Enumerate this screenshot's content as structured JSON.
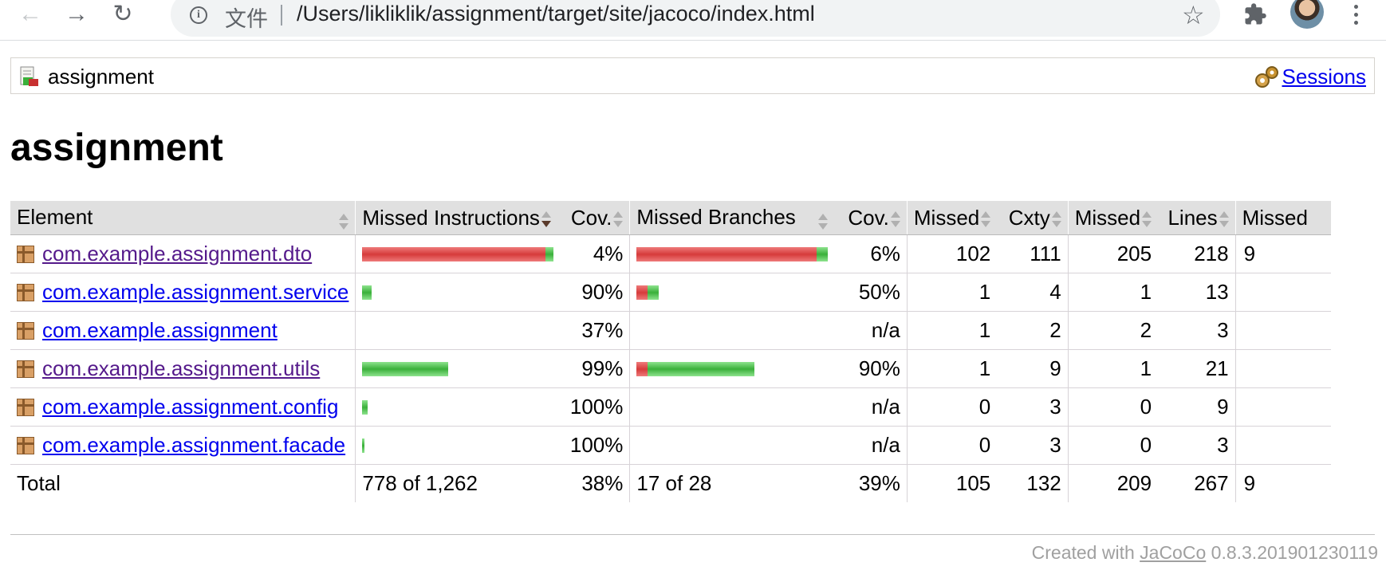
{
  "browser": {
    "scheme_label": "文件",
    "url": "/Users/likliklik/assignment/target/site/jacoco/index.html",
    "back_icon": "back-arrow-icon",
    "forward_icon": "forward-arrow-icon",
    "reload_icon": "reload-icon",
    "info_icon": "info-icon",
    "star_icon": "star-icon",
    "extensions_icon": "puzzle-icon",
    "menu_icon": "three-dots-icon"
  },
  "breadcrumb": {
    "label": "assignment",
    "sessions_label": "Sessions"
  },
  "page": {
    "title": "assignment"
  },
  "table": {
    "headers": {
      "element": "Element",
      "missed_instructions": "Missed Instructions",
      "cov1": "Cov.",
      "missed_branches": "Missed Branches",
      "cov2": "Cov.",
      "missed_cxty": "Missed",
      "cxty": "Cxty",
      "missed_lines": "Missed",
      "lines": "Lines",
      "missed_methods": "Missed"
    },
    "rows": [
      {
        "name": "com.example.assignment.dto",
        "visited": true,
        "instr_missed_frac": 0.96,
        "instr_covered_frac": 0.04,
        "instr_cov": "4%",
        "br_missed_frac": 0.94,
        "br_covered_frac": 0.06,
        "br_cov": "6%",
        "missed_cxty": "102",
        "cxty": "111",
        "missed_lines": "205",
        "lines": "218",
        "missed_methods": "9"
      },
      {
        "name": "com.example.assignment.service",
        "visited": false,
        "instr_missed_frac": 0.0,
        "instr_covered_frac": 0.05,
        "instr_cov": "90%",
        "br_missed_frac": 0.06,
        "br_covered_frac": 0.06,
        "br_cov": "50%",
        "missed_cxty": "1",
        "cxty": "4",
        "missed_lines": "1",
        "lines": "13",
        "missed_methods": ""
      },
      {
        "name": "com.example.assignment",
        "visited": false,
        "instr_missed_frac": 0,
        "instr_covered_frac": 0,
        "instr_cov": "37%",
        "br_missed_frac": 0,
        "br_covered_frac": 0,
        "br_cov": "n/a",
        "missed_cxty": "1",
        "cxty": "2",
        "missed_lines": "2",
        "lines": "3",
        "missed_methods": ""
      },
      {
        "name": "com.example.assignment.utils",
        "visited": true,
        "instr_missed_frac": 0.0,
        "instr_covered_frac": 0.45,
        "instr_cov": "99%",
        "br_missed_frac": 0.06,
        "br_covered_frac": 0.56,
        "br_cov": "90%",
        "missed_cxty": "1",
        "cxty": "9",
        "missed_lines": "1",
        "lines": "21",
        "missed_methods": ""
      },
      {
        "name": "com.example.assignment.config",
        "visited": false,
        "instr_missed_frac": 0,
        "instr_covered_frac": 0.03,
        "instr_cov": "100%",
        "br_missed_frac": 0,
        "br_covered_frac": 0,
        "br_cov": "n/a",
        "missed_cxty": "0",
        "cxty": "3",
        "missed_lines": "0",
        "lines": "9",
        "missed_methods": ""
      },
      {
        "name": "com.example.assignment.facade",
        "visited": false,
        "instr_missed_frac": 0,
        "instr_covered_frac": 0.01,
        "instr_cov": "100%",
        "br_missed_frac": 0,
        "br_covered_frac": 0,
        "br_cov": "n/a",
        "missed_cxty": "0",
        "cxty": "3",
        "missed_lines": "0",
        "lines": "3",
        "missed_methods": ""
      }
    ],
    "total": {
      "label": "Total",
      "instr": "778 of 1,262",
      "instr_cov": "38%",
      "br": "17 of 28",
      "br_cov": "39%",
      "missed_cxty": "105",
      "cxty": "132",
      "missed_lines": "209",
      "lines": "267",
      "missed_methods": "9"
    }
  },
  "footer": {
    "prefix": "Created with ",
    "link": "JaCoCo",
    "version": " 0.8.3.201901230119"
  },
  "colors": {
    "missed_bar": "#d63b3b",
    "covered_bar": "#3ab03a",
    "header_bg": "#e0e0e0",
    "link": "#0000ee",
    "visited_link": "#551a8b"
  }
}
